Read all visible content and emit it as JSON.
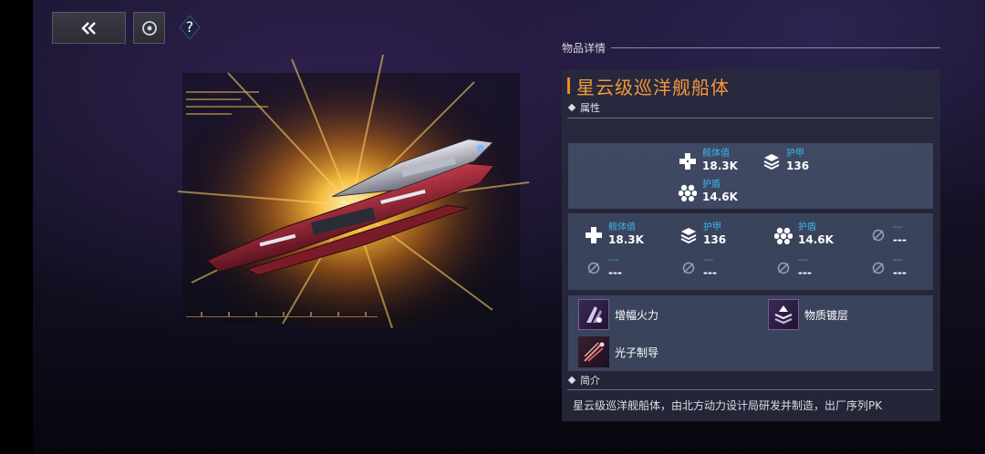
{
  "nav": {
    "back_icon": "double-chevron-left-icon",
    "target_icon": "target-icon",
    "help_icon": "question-mark-icon"
  },
  "detail": {
    "header_label": "物品详情",
    "item_name": "星云级巡洋舰船体",
    "attributes_label": "属性",
    "intro_label": "简介",
    "intro_text": "星云级巡洋舰船体，由北方动力设计局研发并制造，出厂序列PK"
  },
  "base_stats": [
    {
      "icon": "hull-cross-icon",
      "label": "舰体值",
      "value": "18.3K"
    },
    {
      "icon": "armor-layers-icon",
      "label": "护甲",
      "value": "136"
    },
    {
      "icon": "shield-hex-icon",
      "label": "护盾",
      "value": "14.6K"
    }
  ],
  "module_stats": [
    {
      "icon": "hull-cross-icon",
      "label": "舰体值",
      "value": "18.3K"
    },
    {
      "icon": "armor-layers-icon",
      "label": "护甲",
      "value": "136"
    },
    {
      "icon": "shield-hex-icon",
      "label": "护盾",
      "value": "14.6K"
    },
    {
      "icon": "empty-slot-icon",
      "label": "---",
      "value": "---"
    },
    {
      "icon": "empty-slot-icon",
      "label": "---",
      "value": "---"
    },
    {
      "icon": "empty-slot-icon",
      "label": "---",
      "value": "---"
    },
    {
      "icon": "empty-slot-icon",
      "label": "---",
      "value": "---"
    },
    {
      "icon": "empty-slot-icon",
      "label": "---",
      "value": "---"
    }
  ],
  "skills": [
    {
      "icon": "firepower-boost-icon",
      "name": "增幅火力"
    },
    {
      "icon": "material-plating-icon",
      "name": "物质镀层"
    },
    {
      "icon": "photon-guidance-icon",
      "name": "光子制导"
    }
  ],
  "colors": {
    "title_orange": "#f39a38",
    "stat_label_blue": "#38b6f0",
    "panel_bg": "#282a3c"
  }
}
